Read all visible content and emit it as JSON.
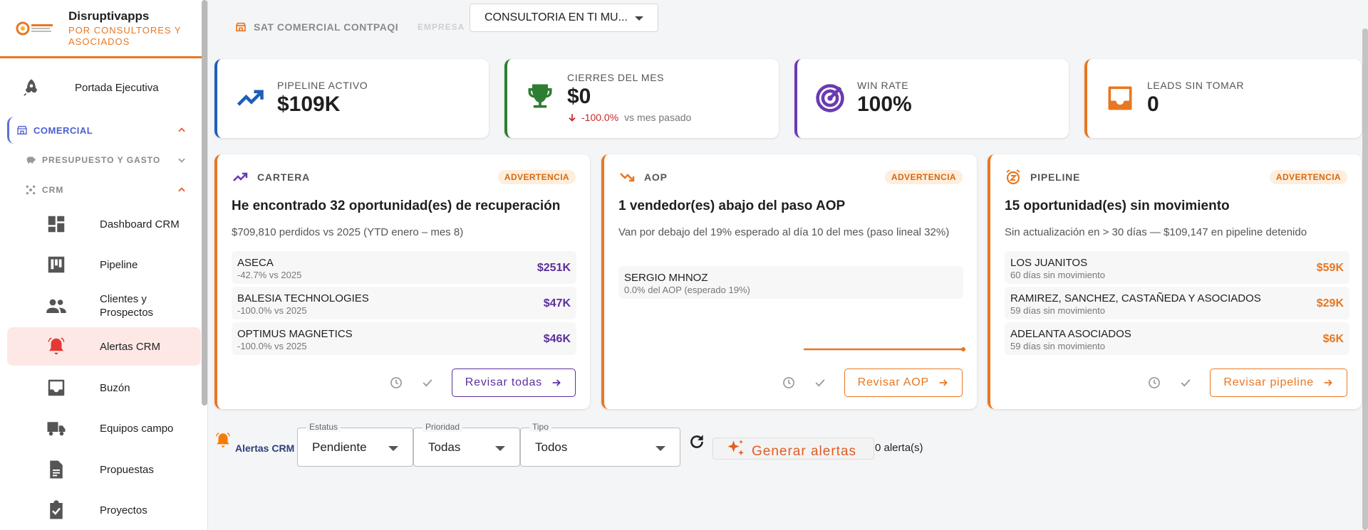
{
  "brand": {
    "title": "Disruptivapps",
    "subtitle": "POR CONSULTORES Y ASOCIADOS"
  },
  "sidebar": {
    "exec": "Portada Ejecutiva",
    "section_comercial": "COMERCIAL",
    "section_presupuesto": "PRESUPUESTO Y GASTO",
    "section_crm": "CRM",
    "items": [
      {
        "label": "Dashboard CRM",
        "icon": "dashboard-icon"
      },
      {
        "label": "Pipeline",
        "icon": "kanban-icon"
      },
      {
        "label": "Clientes y Prospectos",
        "icon": "people-icon"
      },
      {
        "label": "Alertas CRM",
        "icon": "bell-alert-icon"
      },
      {
        "label": "Buzón",
        "icon": "inbox-icon"
      },
      {
        "label": "Equipos campo",
        "icon": "truck-icon"
      },
      {
        "label": "Propuestas",
        "icon": "document-icon"
      },
      {
        "label": "Proyectos",
        "icon": "clipboard-check-icon"
      }
    ]
  },
  "topbar": {
    "tag": "SAT COMERCIAL CONTPAQI",
    "empresa_label": "EMPRESA",
    "empresa_value": "CONSULTORIA EN TI MU..."
  },
  "kpis": [
    {
      "label": "PIPELINE ACTIVO",
      "value": "$109K",
      "color": "#1d5fb8"
    },
    {
      "label": "CIERRES DEL MES",
      "value": "$0",
      "delta": "-100.0%",
      "delta_suffix": "vs mes pasado",
      "color": "#2e7d32"
    },
    {
      "label": "WIN RATE",
      "value": "100%",
      "color": "#6a3ab2"
    },
    {
      "label": "LEADS SIN TOMAR",
      "value": "0",
      "color": "#e87722"
    }
  ],
  "cards": [
    {
      "category": "CARTERA",
      "badge": "ADVERTENCIA",
      "title": "He encontrado 32 oportunidad(es) de recuperación",
      "desc": "$709,810 perdidos vs 2025 (YTD enero – mes 8)",
      "rows": [
        {
          "name": "ASECA",
          "sub": "-42.7% vs 2025",
          "value": "$251K"
        },
        {
          "name": "BALESIA TECHNOLOGIES",
          "sub": "-100.0% vs 2025",
          "value": "$47K"
        },
        {
          "name": "OPTIMUS MAGNETICS",
          "sub": "-100.0% vs 2025",
          "value": "$46K"
        }
      ],
      "button": "Revisar todas",
      "value_color": "#5b2f9e"
    },
    {
      "category": "AOP",
      "badge": "ADVERTENCIA",
      "title": "1 vendedor(es) abajo del paso AOP",
      "desc": "Van por debajo del 19% esperado al día 10 del mes (paso lineal 32%)",
      "rows": [
        {
          "name": "SERGIO MHNOZ",
          "sub": "0.0% del AOP (esperado 19%)"
        }
      ],
      "button": "Revisar AOP"
    },
    {
      "category": "PIPELINE",
      "badge": "ADVERTENCIA",
      "title": "15 oportunidad(es) sin movimiento",
      "desc": "Sin actualización en > 30 días — $109,147 en pipeline detenido",
      "rows": [
        {
          "name": "LOS JUANITOS",
          "sub": "60 días sin movimiento",
          "value": "$59K"
        },
        {
          "name": "RAMIREZ, SANCHEZ, CASTAÑEDA Y ASOCIADOS",
          "sub": "59 días sin movimiento",
          "value": "$29K"
        },
        {
          "name": "ADELANTA ASOCIADOS",
          "sub": "59 días sin movimiento",
          "value": "$6K"
        }
      ],
      "button": "Revisar pipeline",
      "value_color": "#e87722"
    }
  ],
  "filters": {
    "title": "Alertas CRM",
    "estatus_label": "Estatus",
    "estatus_value": "Pendiente",
    "prioridad_label": "Prioridad",
    "prioridad_value": "Todas",
    "tipo_label": "Tipo",
    "tipo_value": "Todos",
    "generate": "Generar alertas",
    "count": "0 alerta(s)"
  },
  "colors": {
    "accent": "#e87722",
    "indigo": "#4c5fd0",
    "purple": "#5b2f9e",
    "alert_red": "#e53935"
  }
}
